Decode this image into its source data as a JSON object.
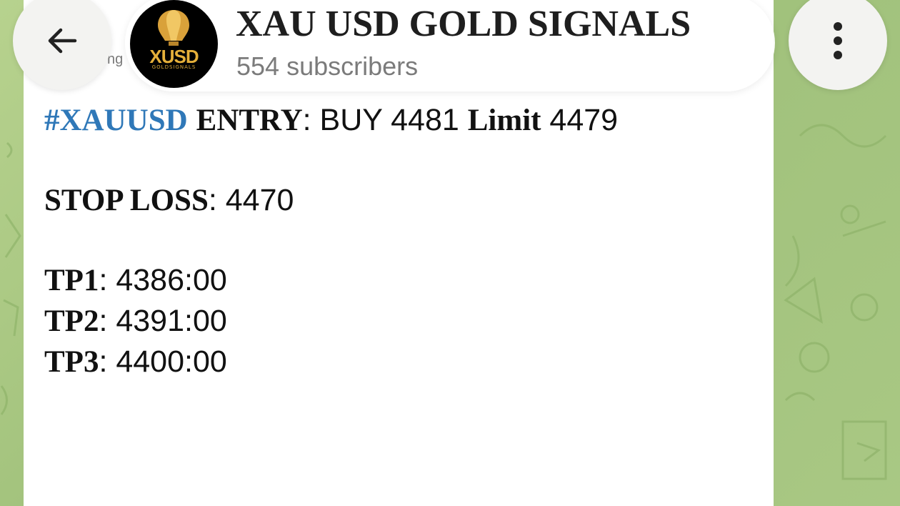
{
  "header": {
    "title": "XAU USD GOLD SIGNALS",
    "subscribers": "554 subscribers",
    "back_icon": "arrow-left-icon",
    "menu_icon": "more-vertical-icon",
    "avatar_brand": "XUSD",
    "avatar_sub": "GOLDSIGNALS",
    "peek_text": "ng"
  },
  "message": {
    "line1": {
      "hashtag": "#XAUUSD",
      "entry_label": "ENTRY",
      "entry_value": ": BUY 4481 ",
      "limit_label": "Limit",
      "limit_value": " 4479"
    },
    "line2": {
      "label": "STOP LOSS",
      "value": ": 4470"
    },
    "tps": [
      {
        "label": "TP1",
        "value": ": 4386:00"
      },
      {
        "label": "TP2",
        "value": ": 4391:00"
      },
      {
        "label": "TP3",
        "value": ": 4400:00"
      }
    ]
  },
  "colors": {
    "hashtag": "#2f78b8",
    "background": "#a9c884"
  }
}
